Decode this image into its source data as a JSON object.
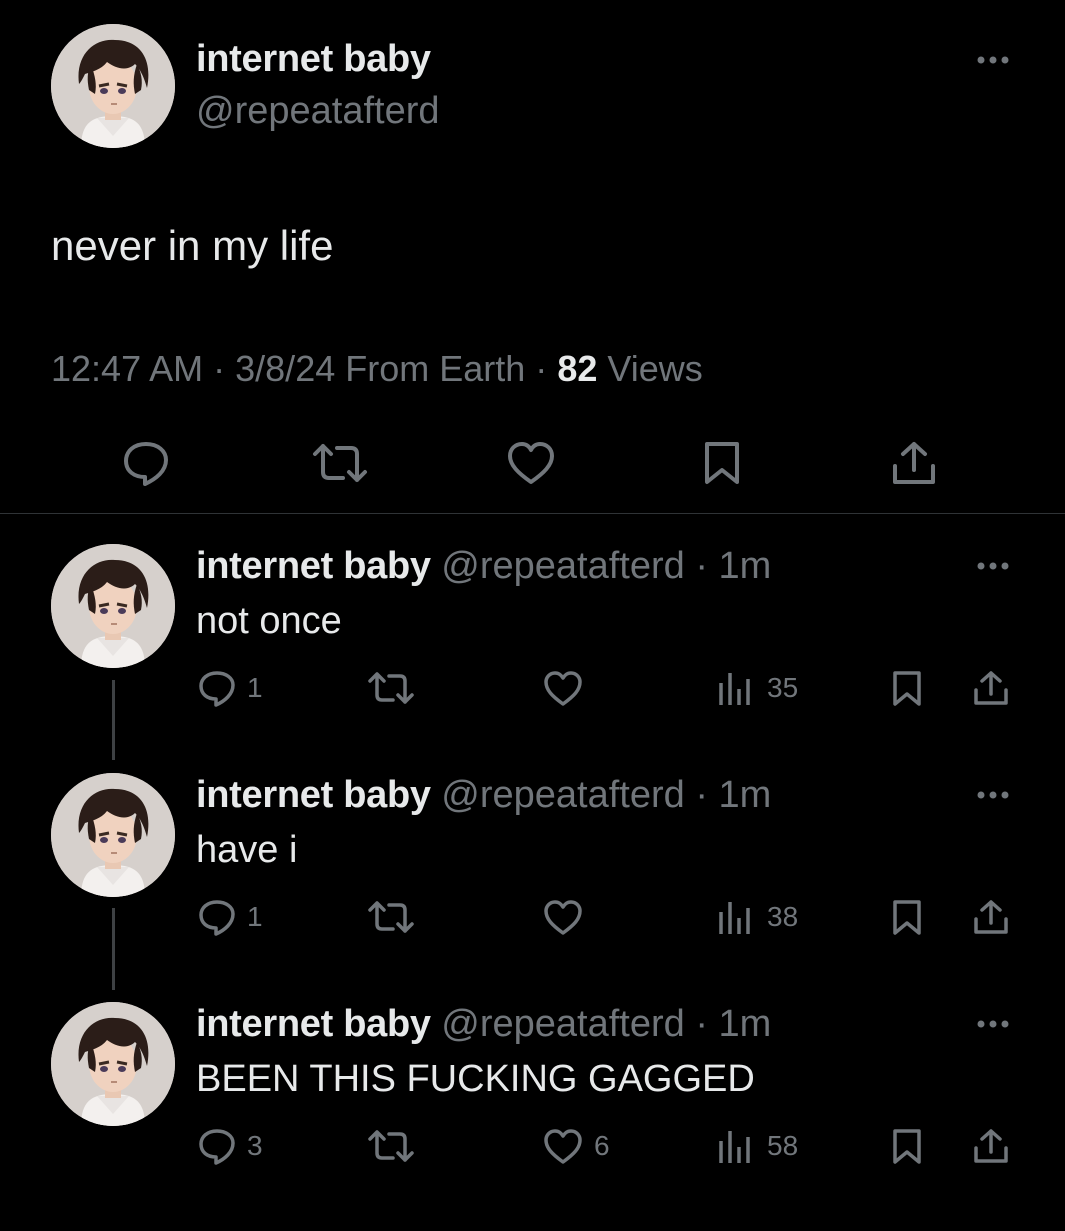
{
  "main": {
    "display_name": "internet baby",
    "handle": "@repeatafterd",
    "text": "never in my life",
    "time": "12:47 AM",
    "dot1": "·",
    "date_source": "3/8/24 From Earth",
    "dot2": "·",
    "views_count": "82",
    "views_label": "Views",
    "icons": [
      "reply-icon",
      "retweet-icon",
      "like-icon",
      "bookmark-icon",
      "share-icon"
    ]
  },
  "replies": [
    {
      "display_name": "internet baby",
      "handle": "@repeatafterd",
      "dot": "·",
      "time": "1m",
      "text": "not once",
      "reply_count": "1",
      "like_count": "",
      "views": "35"
    },
    {
      "display_name": "internet baby",
      "handle": "@repeatafterd",
      "dot": "·",
      "time": "1m",
      "text": "have i",
      "reply_count": "1",
      "like_count": "",
      "views": "38"
    },
    {
      "display_name": "internet baby",
      "handle": "@repeatafterd",
      "dot": "·",
      "time": "1m",
      "text": "BEEN THIS FUCKING GAGGED",
      "reply_count": "3",
      "like_count": "6",
      "views": "58"
    }
  ],
  "colors": {
    "background": "#000000",
    "primary_text": "#e7e9ea",
    "secondary_text": "#71767b",
    "divider": "#2f3336",
    "thread_line": "#3e4144"
  }
}
